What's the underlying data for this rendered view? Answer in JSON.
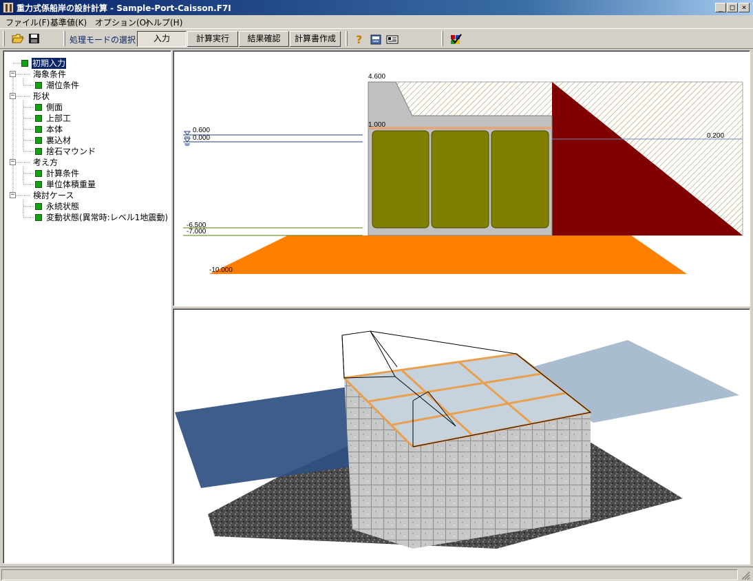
{
  "window": {
    "title": "重力式係船岸の設計計算 - Sample-Port-Caisson.F7I",
    "controls": {
      "minimize": "_",
      "maximize": "□",
      "close": "×"
    }
  },
  "menu": [
    "ファイル(F)",
    "基準値(K)",
    "オプション(O)",
    "ヘルプ(H)"
  ],
  "toolbar": {
    "icons": [
      "open-folder-icon",
      "save-disk-icon",
      "help-question-icon",
      "manual-book-icon",
      "info-card-icon",
      "check-list-icon"
    ],
    "mode_label": "処理モードの選択",
    "modes": [
      "入力",
      "計算実行",
      "結果確認",
      "計算書作成"
    ],
    "active_mode": "入力"
  },
  "tree": {
    "root": "初期入力",
    "groups": [
      {
        "label": "海象条件",
        "children": [
          "潮位条件"
        ]
      },
      {
        "label": "形状",
        "children": [
          "側面",
          "上部工",
          "本体",
          "裏込材",
          "捨石マウンド"
        ]
      },
      {
        "label": "考え方",
        "children": [
          "計算条件",
          "単位体積重量"
        ]
      },
      {
        "label": "検討ケース",
        "children": [
          "永続状態",
          "変動状態(異常時:レベル1地震動)"
        ]
      }
    ]
  },
  "section_view": {
    "labels": {
      "crown": "4.600",
      "hwl": "0.600",
      "lwl": "0.000",
      "cap_bottom": "1.000",
      "residual": "0.200",
      "bottom": "-6.500",
      "mound_top": "-7.000",
      "seabed": "-10.000"
    },
    "colors": {
      "cap": "#c0c0c0",
      "fill": "#808000",
      "backfill": "#800000",
      "mound": "#ff8000",
      "water_line": "#1f3f7f",
      "bottom_line": "#4f7f00"
    }
  },
  "model_view": {
    "colors": {
      "sea": "#2e4f80",
      "water_right": "#a9bcd0",
      "gravel": "#4a4a4a",
      "caisson_concrete": "#c8c8c8",
      "partition": "#e8a050"
    }
  }
}
